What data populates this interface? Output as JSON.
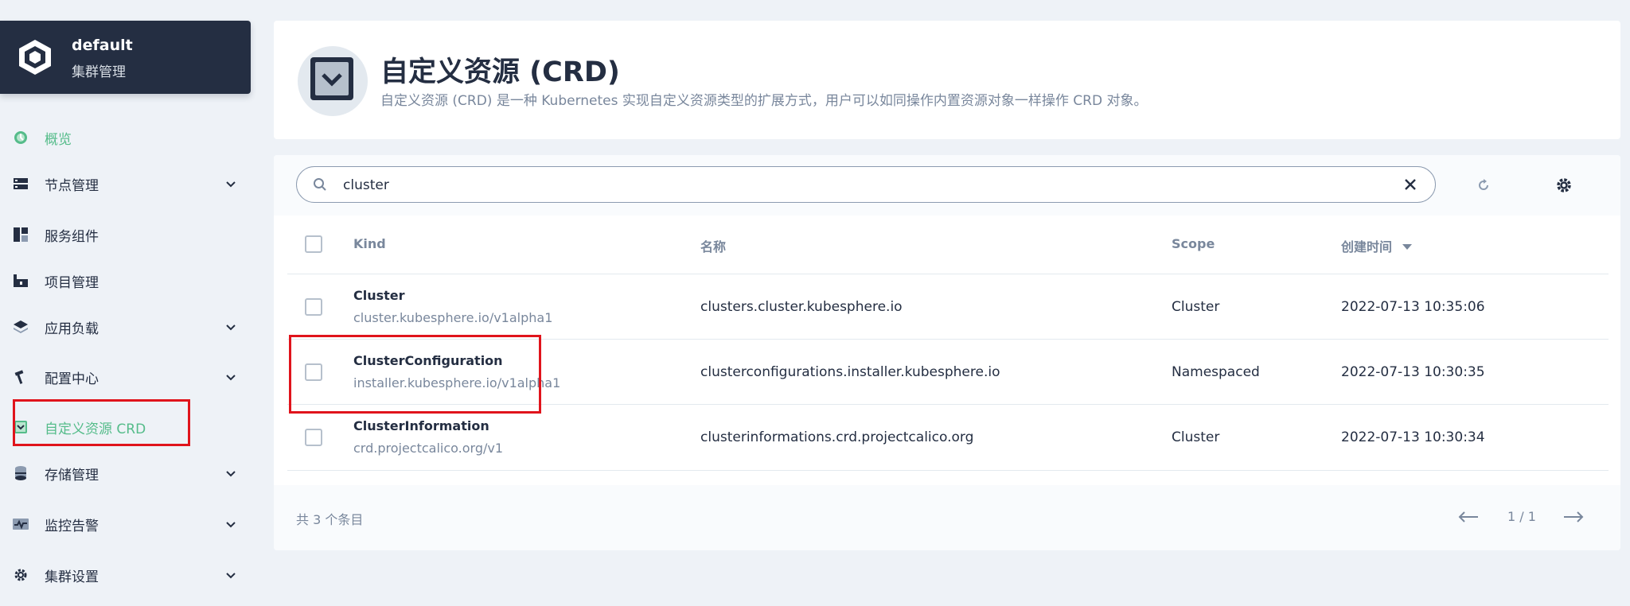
{
  "cluster": {
    "name": "default",
    "subtitle": "集群管理"
  },
  "nav": [
    {
      "label": "概览",
      "icon": "dashboard-icon",
      "active": true,
      "expandable": false
    },
    {
      "label": "节点管理",
      "icon": "nodes-icon",
      "active": false,
      "expandable": true
    },
    {
      "label": "服务组件",
      "icon": "components-icon",
      "active": false,
      "expandable": false
    },
    {
      "label": "项目管理",
      "icon": "project-icon",
      "active": false,
      "expandable": false
    },
    {
      "label": "应用负载",
      "icon": "layers-icon",
      "active": false,
      "expandable": true
    },
    {
      "label": "配置中心",
      "icon": "hammer-icon",
      "active": false,
      "expandable": true
    },
    {
      "label": "自定义资源 CRD",
      "icon": "crd-icon",
      "active": true,
      "expandable": false
    },
    {
      "label": "存储管理",
      "icon": "database-icon",
      "active": false,
      "expandable": true
    },
    {
      "label": "监控告警",
      "icon": "monitor-icon",
      "active": false,
      "expandable": true
    },
    {
      "label": "集群设置",
      "icon": "gear-icon",
      "active": false,
      "expandable": true
    }
  ],
  "header": {
    "title": "自定义资源 (CRD)",
    "description": "自定义资源 (CRD) 是一种 Kubernetes 实现自定义资源类型的扩展方式，用户可以如同操作内置资源对象一样操作 CRD 对象。"
  },
  "search": {
    "value": "cluster"
  },
  "table": {
    "columns": {
      "kind": "Kind",
      "name": "名称",
      "scope": "Scope",
      "created": "创建时间"
    },
    "rows": [
      {
        "kind": "Cluster",
        "group": "cluster.kubesphere.io/v1alpha1",
        "name": "clusters.cluster.kubesphere.io",
        "scope": "Cluster",
        "created": "2022-07-13 10:35:06"
      },
      {
        "kind": "ClusterConfiguration",
        "group": "installer.kubesphere.io/v1alpha1",
        "name": "clusterconfigurations.installer.kubesphere.io",
        "scope": "Namespaced",
        "created": "2022-07-13 10:30:35"
      },
      {
        "kind": "ClusterInformation",
        "group": "crd.projectcalico.org/v1",
        "name": "clusterinformations.crd.projectcalico.org",
        "scope": "Cluster",
        "created": "2022-07-13 10:30:34"
      }
    ]
  },
  "footer": {
    "total": "共 3 个条目",
    "page": "1 / 1"
  },
  "colors": {
    "accent": "#55bc8a",
    "highlight": "#e0141c",
    "dark": "#242e42"
  }
}
